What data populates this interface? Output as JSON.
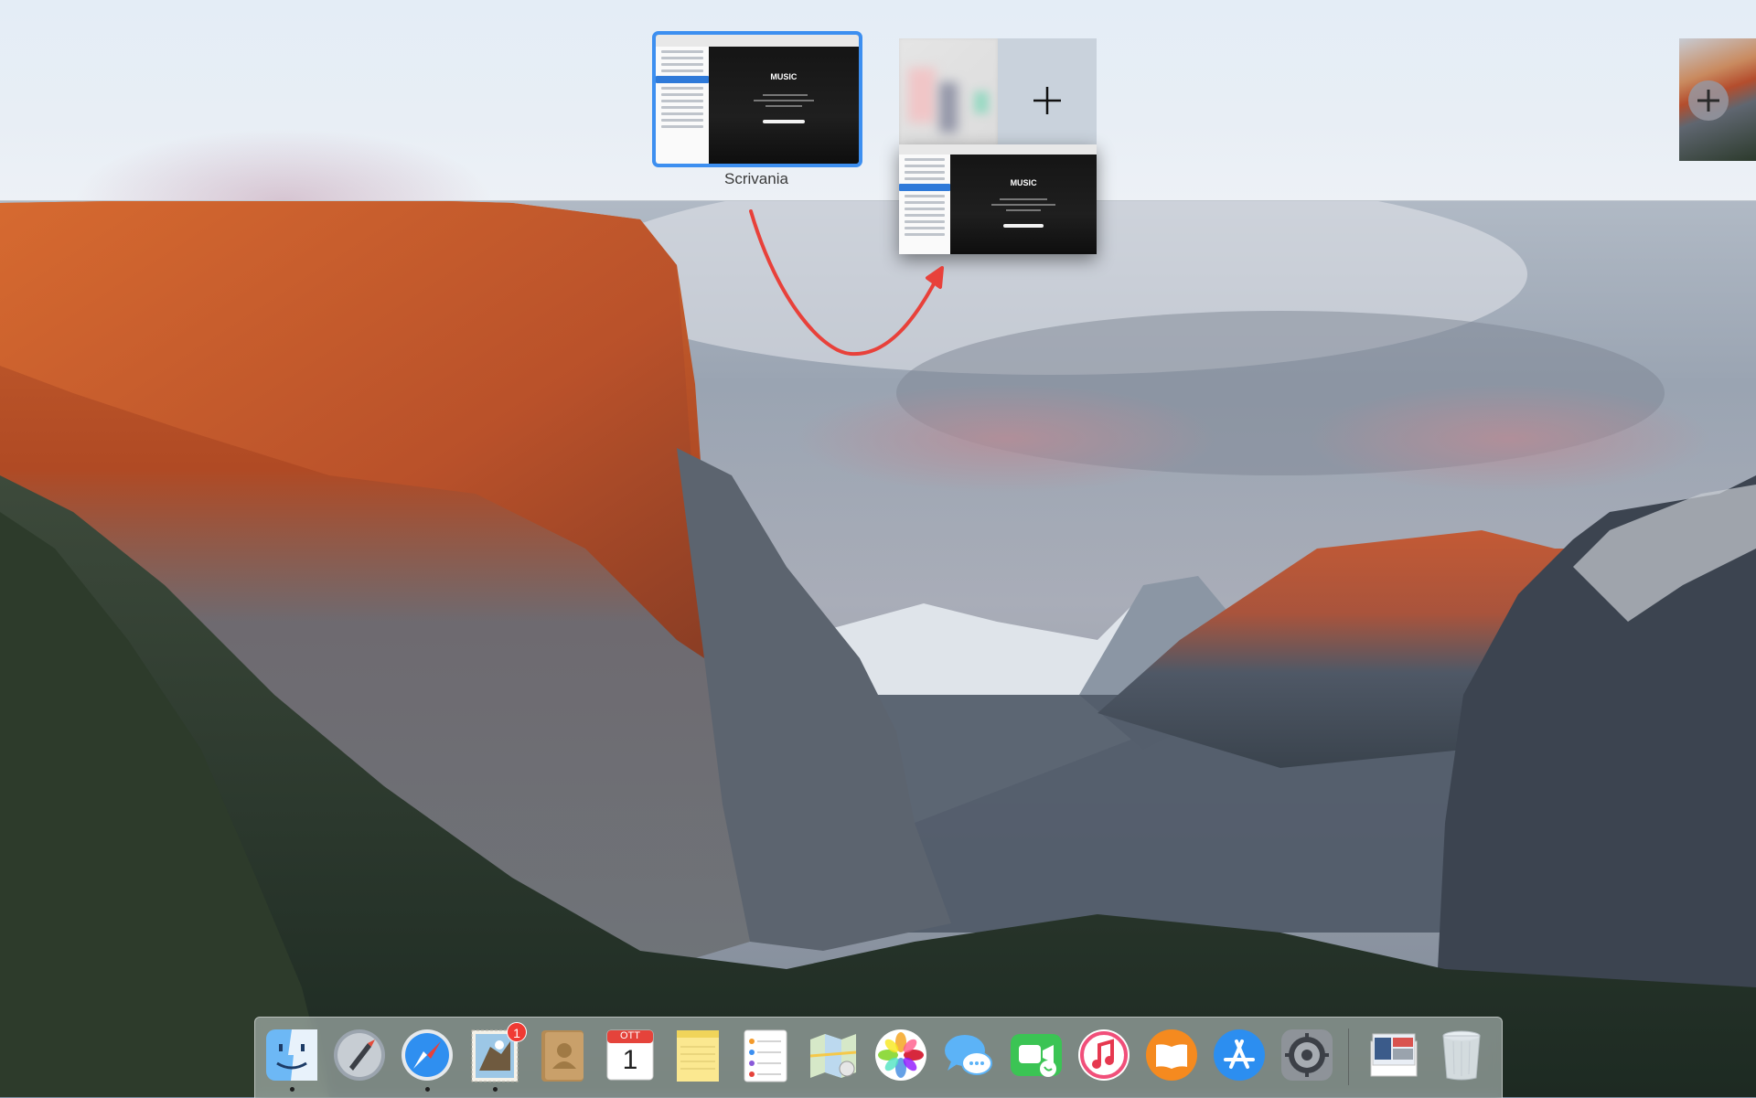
{
  "mission_control": {
    "spaces": [
      {
        "label": "Scrivania",
        "selected": true,
        "app_logo": "MUSIC"
      }
    ],
    "add_space": {
      "icon": "plus-icon"
    },
    "dragged_window": {
      "app_logo": "MUSIC"
    },
    "right_edge_add": {
      "icon": "plus-icon"
    }
  },
  "dock": {
    "items": [
      {
        "name": "finder",
        "icon": "finder-icon",
        "running": true
      },
      {
        "name": "launchpad",
        "icon": "rocket-icon",
        "running": false
      },
      {
        "name": "safari",
        "icon": "compass-icon",
        "running": true
      },
      {
        "name": "mail",
        "icon": "eagle-stamp-icon",
        "running": true,
        "badge": "1"
      },
      {
        "name": "contacts",
        "icon": "contacts-book-icon",
        "running": false
      },
      {
        "name": "calendar",
        "icon": "calendar-icon",
        "running": false,
        "month": "OTT",
        "day": "1"
      },
      {
        "name": "notes",
        "icon": "notepad-icon",
        "running": false
      },
      {
        "name": "reminders",
        "icon": "checklist-icon",
        "running": false
      },
      {
        "name": "maps",
        "icon": "map-icon",
        "running": false
      },
      {
        "name": "photos",
        "icon": "flower-icon",
        "running": false
      },
      {
        "name": "messages",
        "icon": "chat-bubbles-icon",
        "running": false
      },
      {
        "name": "facetime",
        "icon": "video-camera-icon",
        "running": false
      },
      {
        "name": "itunes",
        "icon": "music-note-icon",
        "running": false
      },
      {
        "name": "ibooks",
        "icon": "open-book-icon",
        "running": false
      },
      {
        "name": "app-store",
        "icon": "app-store-icon",
        "running": false
      },
      {
        "name": "system-preferences",
        "icon": "gear-icon",
        "running": false
      },
      {
        "name": "documents-stack",
        "icon": "stack-icon",
        "running": false
      },
      {
        "name": "trash",
        "icon": "trash-icon",
        "running": false
      }
    ]
  },
  "colors": {
    "selection_outline": "#3d8ff0",
    "arrow": "#e8413a",
    "badge": "#f03a33"
  }
}
